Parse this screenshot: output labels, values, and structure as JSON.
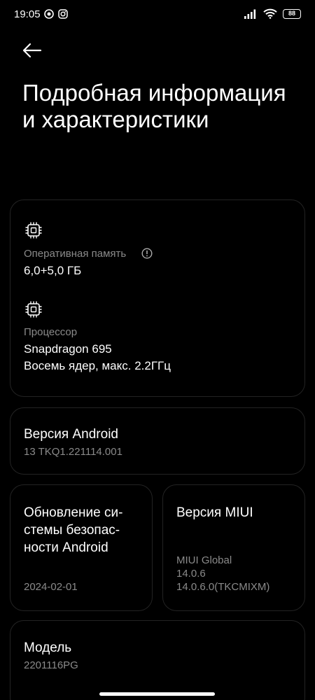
{
  "status_bar": {
    "time": "19:05",
    "battery": "88"
  },
  "header": {
    "title": "Подробная информация и характеристики"
  },
  "memory": {
    "label": "Оперативная память",
    "value": "6,0+5,0 ГБ"
  },
  "processor": {
    "label": "Процессор",
    "value_line1": "Snapdragon 695",
    "value_line2": "Восемь ядер, макс. 2.2ГГц"
  },
  "android_version": {
    "title": "Версия Android",
    "value": "13 TKQ1.221114.001"
  },
  "security_update": {
    "title_line1": "Обновление си-",
    "title_line2": "стемы безопас-",
    "title_line3": "ности Android",
    "value": "2024-02-01"
  },
  "miui_version": {
    "title": "Версия MIUI",
    "line1": "MIUI Global",
    "line2": "14.0.6",
    "line3": "14.0.6.0(TKCMIXM)"
  },
  "model": {
    "title": "Модель",
    "value": "2201116PG"
  }
}
